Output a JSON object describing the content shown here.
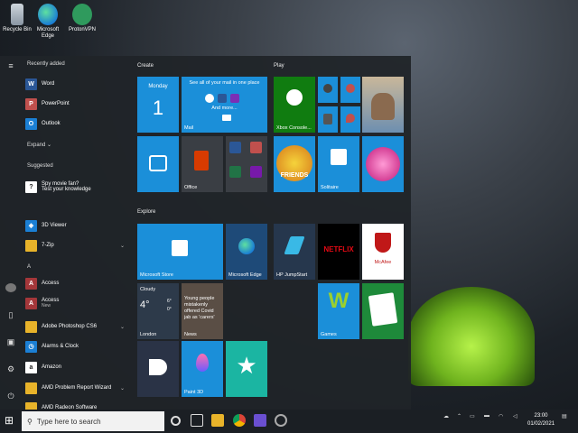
{
  "desktop": {
    "icons": [
      {
        "label": "Recycle Bin"
      },
      {
        "label": "Microsoft Edge"
      },
      {
        "label": "ProtonVPN"
      }
    ]
  },
  "start_menu": {
    "recently_added_heading": "Recently added",
    "recent_apps": [
      "Word",
      "PowerPoint",
      "Outlook"
    ],
    "expand_label": "Expand",
    "suggested_heading": "Suggested",
    "suggested_app": {
      "title": "Spy movie fan?",
      "subtitle": "Test your knowledge"
    },
    "apps": [
      {
        "label": "3D Viewer",
        "color": "#1b7fd4"
      },
      {
        "label": "7-Zip",
        "color": "#e8b32a"
      },
      {
        "label": "A",
        "is_header": true
      },
      {
        "label": "Access",
        "color": "#a4373a"
      },
      {
        "label": "Access",
        "sub": "New",
        "color": "#a4373a"
      },
      {
        "label": "Adobe Photoshop CS6",
        "color": "#e8b32a"
      },
      {
        "label": "Alarms & Clock",
        "color": "#1b7fd4"
      },
      {
        "label": "Amazon",
        "color": "#ffffff"
      },
      {
        "label": "AMD Problem Report Wizard",
        "color": "#e8b32a"
      },
      {
        "label": "AMD Radeon Software",
        "color": "#e8b32a"
      }
    ],
    "groups": {
      "create": "Create",
      "play": "Play",
      "explore": "Explore"
    },
    "tiles": {
      "calendar_day": "Monday",
      "calendar_date": "1",
      "mail_caption": "See all of your mail in one place",
      "mail_more": "And more...",
      "mail_label": "Mail",
      "office_label": "Office",
      "xbox_label": "Xbox Console...",
      "friends_label": "FRIENDS",
      "solitaire_label": "Solitaire",
      "store_label": "Microsoft Store",
      "edge_label": "Microsoft Edge",
      "hp_label": "HP JumpStart",
      "netflix_label": "NETFLIX",
      "mcafee_label": "McAfee",
      "weather_condition": "Cloudy",
      "weather_temp": "4°",
      "weather_low": "0°",
      "weather_high": "6°",
      "weather_city": "London",
      "news_headline": "Young people mistakenly offered Covid jab as 'carers'",
      "news_label": "News",
      "games_label": "Games",
      "paint3d_label": "Paint 3D"
    }
  },
  "taskbar": {
    "search_placeholder": "Type here to search",
    "time": "23:00",
    "date": "01/02/2021"
  }
}
